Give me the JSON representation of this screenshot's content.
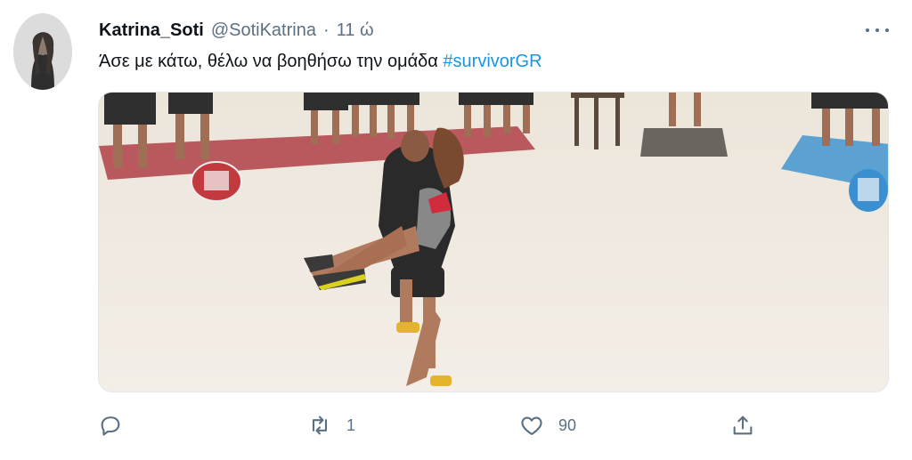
{
  "tweet": {
    "display_name": "Katrina_Soti",
    "handle": "@SotiKatrina",
    "separator": "·",
    "time": "11 ώ",
    "text": "Άσε με κάτω, θέλω να βοηθήσω την ομάδα",
    "hashtag": "#survivorGR",
    "media_icon": "image",
    "colors": {
      "hashtag": "#1b95e0",
      "secondary_text": "#5b7083",
      "primary_text": "#0f1419"
    }
  },
  "actions": {
    "reply_icon": "reply-icon",
    "retweet_icon": "retweet-icon",
    "retweet_count": "1",
    "like_icon": "heart-icon",
    "like_count": "90",
    "share_icon": "share-icon"
  },
  "more_icon": "more-dots-icon"
}
